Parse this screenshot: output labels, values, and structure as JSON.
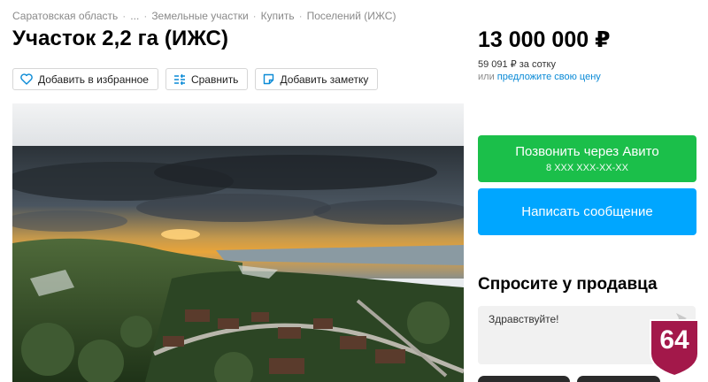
{
  "breadcrumbs": [
    "Саратовская область",
    "...",
    "Земельные участки",
    "Купить",
    "Поселений (ИЖС)"
  ],
  "breadcrumb_separator": "·",
  "title": "Участок 2,2 га (ИЖС)",
  "actions": {
    "favorite": "Добавить в избранное",
    "compare": "Сравнить",
    "note": "Добавить заметку"
  },
  "price": {
    "main": "13 000 000 ₽",
    "per_unit": "59 091 ₽ за сотку",
    "offer_prefix": "или",
    "offer_link": "предложите свою цену"
  },
  "call": {
    "label": "Позвонить через Авито",
    "phone": "8 XXX XXX-XX-XX"
  },
  "message_button": "Написать сообщение",
  "ask_seller": {
    "heading": "Спросите у продавца",
    "message": "Здравствуйте!"
  },
  "badge": "64",
  "colors": {
    "call_green": "#1bbf4a",
    "message_blue": "#00a6ff",
    "link_blue": "#0a8ad6",
    "badge_red": "#a3184a"
  },
  "icons": [
    "heart-icon",
    "compare-icon",
    "note-icon",
    "send-arrow-icon"
  ]
}
